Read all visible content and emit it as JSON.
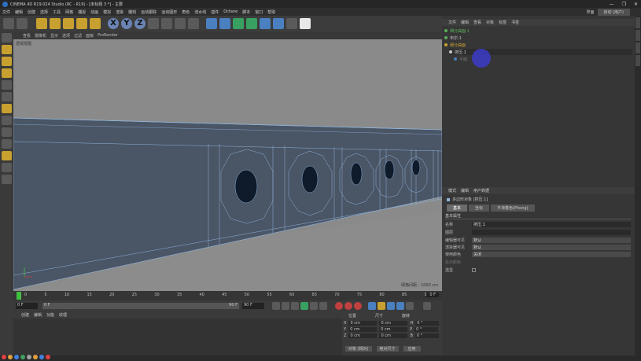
{
  "window": {
    "title": "CINEMA 4D R19.024 Studio (RC - R19) - [未标题 3 *] - 主要",
    "controls": [
      "—",
      "❐",
      "✕"
    ]
  },
  "menubar": {
    "items": [
      "文件",
      "编辑",
      "创建",
      "选择",
      "工具",
      "网格",
      "捕捉",
      "动画",
      "模拟",
      "渲染",
      "雕刻",
      "运动跟踪",
      "运动图形",
      "角色",
      "流水线",
      "插件",
      "Octane",
      "脚本",
      "窗口",
      "帮助"
    ],
    "layout_label": "界面",
    "layout_value": "启动 (用户)"
  },
  "toolbar": {
    "axis_buttons": [
      "X",
      "Y",
      "Z"
    ]
  },
  "viewport": {
    "menu": [
      "查看",
      "摄像机",
      "显示",
      "选项",
      "过滤",
      "面板",
      "ProRender"
    ],
    "label": "透视视图",
    "grid_info": "网格间距：1000 cm"
  },
  "timeline": {
    "ticks": [
      "0",
      "5",
      "10",
      "15",
      "20",
      "25",
      "30",
      "35",
      "40",
      "45",
      "50",
      "55",
      "60",
      "65",
      "70",
      "75",
      "80",
      "85",
      "90"
    ],
    "current": "0 F",
    "start": "0 F",
    "start2": "0 F",
    "end": "90 F",
    "end2": "90 F"
  },
  "materials": {
    "tabs": [
      "创建",
      "编辑",
      "功能",
      "纹理"
    ]
  },
  "coords": {
    "headers": [
      "位置",
      "尺寸",
      "旋转"
    ],
    "rows": [
      {
        "axis": "X",
        "pos": "0 cm",
        "size": "0 cm",
        "rotlabel": "H",
        "rot": "0 °"
      },
      {
        "axis": "Y",
        "pos": "0 cm",
        "size": "0 cm",
        "rotlabel": "P",
        "rot": "0 °"
      },
      {
        "axis": "Z",
        "pos": "0 cm",
        "size": "0 cm",
        "rotlabel": "B",
        "rot": "0 °"
      }
    ],
    "mode": "对象 (相对)",
    "size_mode": "绝对尺寸",
    "apply": "应用"
  },
  "object_manager": {
    "tabs": [
      "文件",
      "编辑",
      "查看",
      "对象",
      "标签",
      "书签"
    ],
    "objects": [
      {
        "name": "细分曲面.1",
        "color": "#5ab05a",
        "indent": 0
      },
      {
        "name": "布尔.1",
        "color": "#5ab05a",
        "indent": 0
      },
      {
        "name": "细分曲面",
        "color": "#c8a030",
        "indent": 0
      },
      {
        "name": "挤压.1",
        "color": "#c8c8c8",
        "indent": 6
      },
      {
        "name": "平面",
        "color": "#4a7fc0",
        "indent": 12
      }
    ]
  },
  "attribute_manager": {
    "tabs": [
      "模式",
      "编辑",
      "用户数据"
    ],
    "object_title": "多边形对象 [挤压.1]",
    "subtabs": [
      "基本",
      "坐标",
      "平滑着色(Phong)"
    ],
    "section": "基本属性",
    "fields": [
      {
        "label": "名称",
        "value": "挤压.1"
      },
      {
        "label": "图层",
        "value": ""
      },
      {
        "label": "编辑器可见",
        "value": "默认"
      },
      {
        "label": "渲染器可见",
        "value": "默认"
      },
      {
        "label": "使用颜色",
        "value": "关闭"
      },
      {
        "label": "显示颜色",
        "value": ""
      },
      {
        "label": "透显",
        "value": ""
      }
    ]
  },
  "colors": {
    "accent": "#4a7fc0",
    "selection": "#3c3cdc",
    "viewport_bg": "#8a8a8a",
    "mesh": "#4a5566",
    "wire": "#8fb4d8"
  }
}
